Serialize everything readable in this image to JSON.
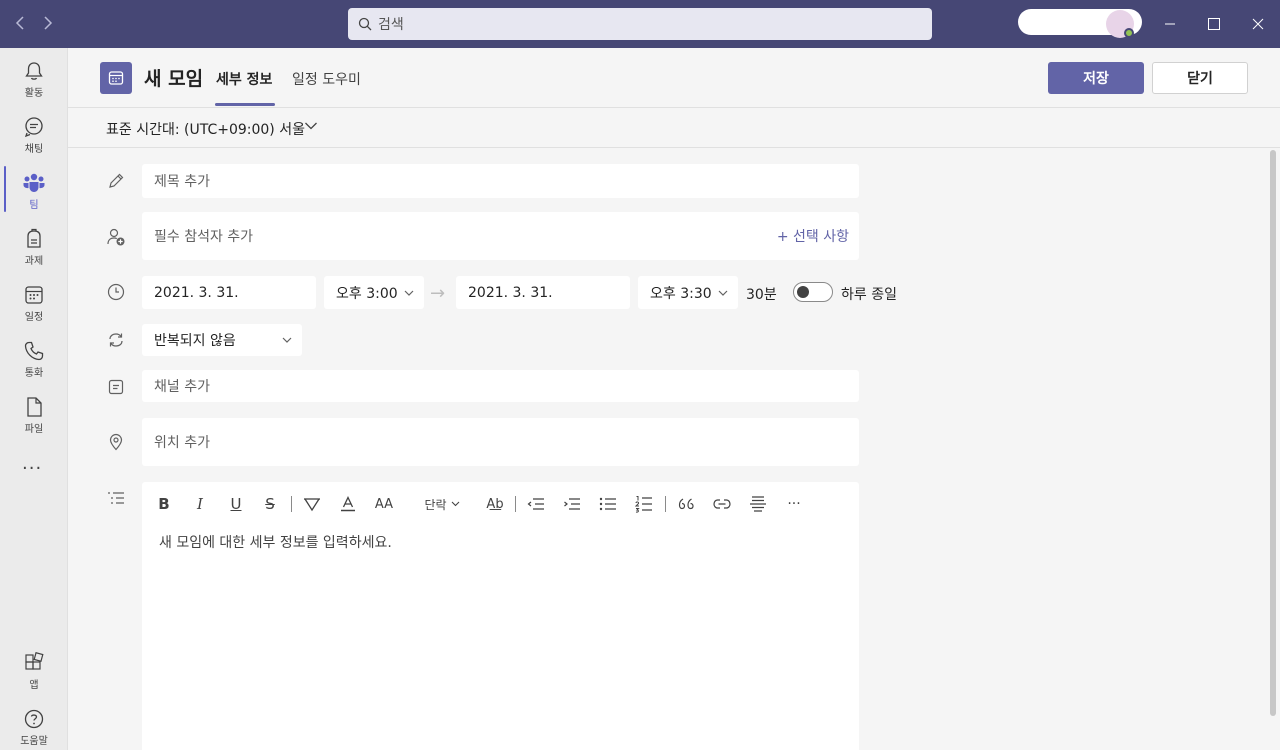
{
  "titlebar": {
    "search_placeholder": "검색"
  },
  "rail": {
    "items": [
      {
        "label": "활동",
        "icon": "bell-icon"
      },
      {
        "label": "채팅",
        "icon": "chat-icon"
      },
      {
        "label": "팀",
        "icon": "teams-icon",
        "active": true
      },
      {
        "label": "과제",
        "icon": "assignments-icon"
      },
      {
        "label": "일정",
        "icon": "calendar-icon"
      },
      {
        "label": "통화",
        "icon": "phone-icon"
      },
      {
        "label": "파일",
        "icon": "file-icon"
      }
    ],
    "more": "···",
    "bottom": [
      {
        "label": "앱",
        "icon": "apps-icon"
      },
      {
        "label": "도움말",
        "icon": "help-icon"
      }
    ]
  },
  "header": {
    "title": "새 모임",
    "tabs": [
      {
        "label": "세부 정보",
        "active": true
      },
      {
        "label": "일정 도우미",
        "active": false
      }
    ],
    "save_label": "저장",
    "close_label": "닫기"
  },
  "timezone": {
    "label": "표준 시간대: (UTC+09:00) 서울"
  },
  "form": {
    "title_placeholder": "제목 추가",
    "attendees_placeholder": "필수 참석자 추가",
    "optional_link": "+ 선택 사항",
    "start_date": "2021. 3. 31.",
    "start_time": "오후 3:00",
    "end_date": "2021. 3. 31.",
    "end_time": "오후 3:30",
    "duration": "30분",
    "all_day_label": "하루 종일",
    "all_day_on": false,
    "repeat": "반복되지 않음",
    "channel_placeholder": "채널 추가",
    "location_placeholder": "위치 추가"
  },
  "editor": {
    "paragraph_label": "단락",
    "placeholder": "새 모임에 대한 세부 정보를 입력하세요.",
    "toolbar_icons": [
      "bold-icon",
      "italic-icon",
      "underline-icon",
      "strikethrough-icon",
      "highlight-icon",
      "font-color-icon",
      "font-size-icon",
      "paragraph-dropdown",
      "clear-format-icon",
      "decrease-indent-icon",
      "increase-indent-icon",
      "bullet-list-icon",
      "numbered-list-icon",
      "quote-icon",
      "link-icon",
      "divider-icon",
      "more-icon"
    ]
  },
  "colors": {
    "accent": "#6264a7",
    "titlebar": "#464775"
  }
}
